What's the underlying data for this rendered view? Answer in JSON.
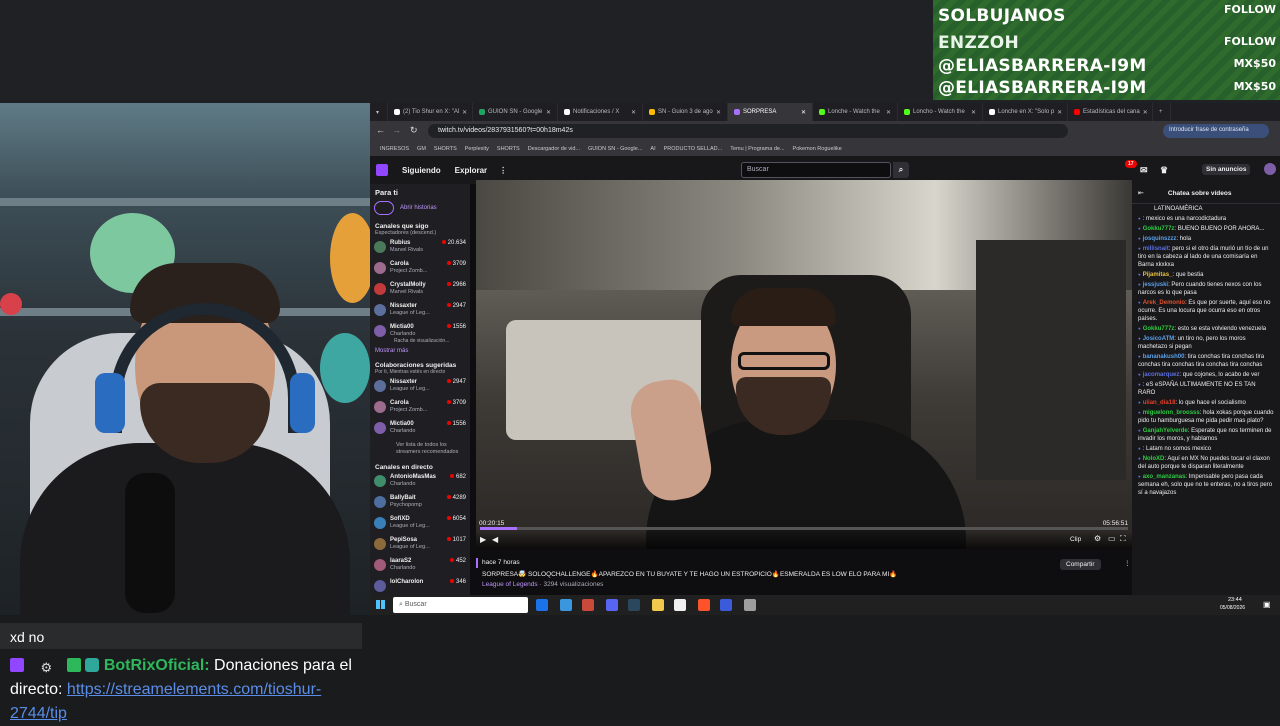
{
  "alerts": [
    {
      "name": "SOLBUJANOS",
      "label": "FOLLOW"
    },
    {
      "name": "ENZZOH",
      "label": "FOLLOW"
    },
    {
      "name": "@ELIASBARRERA-I9M",
      "label": "MX$50"
    },
    {
      "name": "@ELIASBARRERA-I9M",
      "label": "MX$50"
    }
  ],
  "stream_chat": {
    "msg1": "xd no",
    "msg2_user": "BotRixOficial:",
    "msg2_text": " Donaciones para el directo: ",
    "msg2_link": "https://streamelements.com/tioshur-2744/tip"
  },
  "browser": {
    "tabs": [
      "(2) Tio Shur en X: \"Al",
      "GUION SN - Google",
      "Notificaciones / X",
      "SN - Guion 3 de ago",
      "SORPRESA",
      "Lonche - Watch the",
      "Loncho - Watch the",
      "Lonche en X: \"Solo p",
      "Estadísticas del cana"
    ],
    "tab_colors": [
      "#ffffff",
      "#1fa463",
      "#ffffff",
      "#fbbc04",
      "#a970ff",
      "#53fc18",
      "#53fc18",
      "#ffffff",
      "#ff0000"
    ],
    "url": "twitch.tv/videos/2837931560?t=00h18m42s",
    "password_prompt": "Introducir frase de contraseña",
    "bookmarks": [
      "INGRESOS",
      "GM",
      "SHORTS",
      "Perplexity",
      "SHORTS",
      "Descargador de vid...",
      "GUION SN - Google...",
      "AI",
      "PRODUCTO SELLAD...",
      "Temu | Programa de...",
      "Pokemon Roguelike"
    ]
  },
  "twitch": {
    "nav_following": "Siguiendo",
    "nav_explore": "Explorar",
    "search_placeholder": "Buscar",
    "notif_count": "17",
    "no_ads": "Sin anuncios",
    "sidebar": {
      "for_you": "Para ti",
      "open_stories": "Abrir historias",
      "followed_title": "Canales que sigo",
      "followed_sub": "Espectadores (descend.)",
      "followed": [
        {
          "name": "Rubius",
          "game": "Marvel Rivals",
          "count": "20.634",
          "color": "#4a7a5a"
        },
        {
          "name": "Carola",
          "game": "Project Zomb...",
          "count": "3709",
          "color": "#9c6b8e"
        },
        {
          "name": "CrystalMolly",
          "game": "Marvel Rivals",
          "count": "2966",
          "color": "#c23b3b"
        },
        {
          "name": "Nissaxter",
          "game": "League of Leg...",
          "count": "2947",
          "color": "#5b6e9c"
        },
        {
          "name": "Mictia00",
          "game": "Charlando",
          "count": "1556",
          "color": "#7e5ea8"
        }
      ],
      "mictia_note": "Racha de visualización...",
      "show_more": "Mostrar más",
      "collab_title": "Colaboraciones sugeridas",
      "collab_sub": "Por ti, Mientras estés en directo",
      "collab": [
        {
          "name": "Nissaxter",
          "game": "League of Leg...",
          "count": "2947",
          "color": "#5b6e9c"
        },
        {
          "name": "Carola",
          "game": "Project Zomb...",
          "count": "3709",
          "color": "#9c6b8e"
        },
        {
          "name": "Mictia00",
          "game": "Charlando",
          "count": "1556",
          "color": "#7e5ea8"
        }
      ],
      "see_list": "Ver lista de todos los streamers recomendados",
      "live_title": "Canales en directo",
      "live": [
        {
          "name": "AntonioMasMas",
          "game": "Charlando",
          "count": "682",
          "color": "#3f8d6b"
        },
        {
          "name": "BallyBait",
          "game": "Psychopomp",
          "count": "4289",
          "color": "#4e6da0"
        },
        {
          "name": "SofiXD",
          "game": "League of Leg...",
          "count": "6054",
          "color": "#3a80b8"
        },
        {
          "name": "PepiSosa",
          "game": "League of Leg...",
          "count": "1017",
          "color": "#8a6a3a"
        },
        {
          "name": "laaraS2",
          "game": "Charlando",
          "count": "452",
          "color": "#a05a7a"
        },
        {
          "name": "lolCharolon",
          "game": "",
          "count": "346",
          "color": "#5c5c9c"
        }
      ]
    },
    "video": {
      "time_current": "00:20:15",
      "time_total": "05:56:51",
      "progress": 0.057,
      "clip": "Clip",
      "posted": "hace 7 horas",
      "title": "SORPRESA🤯 SOLOQCHALLENGE🔥APAREZCO EN TU BUYATE Y TE HAGO UN ESTROPICIO🔥ESMERALDA ES LOW ELO PARA MI🔥",
      "category": "League of Legends",
      "views": " · 3294 visualizaciones",
      "share": "Compartir"
    },
    "chat": {
      "header": "Chatea sobre vídeos",
      "top_line": "LATINOAMÉRICA",
      "messages": [
        {
          "user": "",
          "color": "#5b6ee0",
          "text": ": mexico es una narcodictadura"
        },
        {
          "user": "Gokku777z",
          "color": "#2ecc40",
          "text": ": BUENO BUENO POR AHORA..."
        },
        {
          "user": "josquinszzz",
          "color": "#5aa0e8",
          "text": ": hola"
        },
        {
          "user": "millisnait",
          "color": "#5b6ee0",
          "text": ": pero si el otro día murió un tío de un tiro en la cabeza al lado de una comisaría en Barna xkxkxa"
        },
        {
          "user": "Pijamitas_",
          "color": "#e8c040",
          "text": ": que bestia"
        },
        {
          "user": "jessjuski",
          "color": "#5aa0e8",
          "text": ": Pero cuando tienes nexos con los narcos es lo que pasa"
        },
        {
          "user": "Arek_Demonio",
          "color": "#e0502a",
          "text": ": Es que por suerte, aquí eso no ocurre. Es una locura que ocurra eso en otros países."
        },
        {
          "user": "Gokku777z",
          "color": "#2ecc40",
          "text": ": esto se esta volviendo venezuela"
        },
        {
          "user": "JosicoATM",
          "color": "#5aa0e8",
          "text": ": un tiro no, pero los moros machetazo si pegan"
        },
        {
          "user": "bananakush00",
          "color": "#5aa0e8",
          "text": ": tira conchas tira conchas tira conchas tira conchas tira conchas tira conchas"
        },
        {
          "user": "jacomarquez",
          "color": "#5b6ee0",
          "text": ": que cojones, lo acabo de ver"
        },
        {
          "user": "",
          "color": "#5b6ee0",
          "text": ": eS eSPAÑA ULTIMAMENTE NO ES TAN RARO"
        },
        {
          "user": "ulian_dia18",
          "color": "#e0402a",
          "text": ": lo que hace el socialismo"
        },
        {
          "user": "miguelonn_broosss",
          "color": "#2ecc40",
          "text": ": hola xokas porque cuando pido tu hamburguesa me pida pedir mas plato?"
        },
        {
          "user": "GanjahYelverde",
          "color": "#2ecc40",
          "text": ": Esperate que nos terminen de invadir los moros, y hablamos"
        },
        {
          "user": "",
          "color": "#5b6ee0",
          "text": ": Latam no somos mexico"
        },
        {
          "user": "NoloXD",
          "color": "#2ecc40",
          "text": ": Aquí en MX No puedes tocar el claxon del auto porque te disparan literalmente"
        },
        {
          "user": "axo_manzanas",
          "color": "#2ecc40",
          "text": ": Impensable pero pasa cada semana eh, solo que no te enteras, no a tiros pero sí a navajazos"
        }
      ]
    }
  },
  "taskbar": {
    "search": "Buscar",
    "time": "23:44",
    "date": "05/08/2026"
  }
}
